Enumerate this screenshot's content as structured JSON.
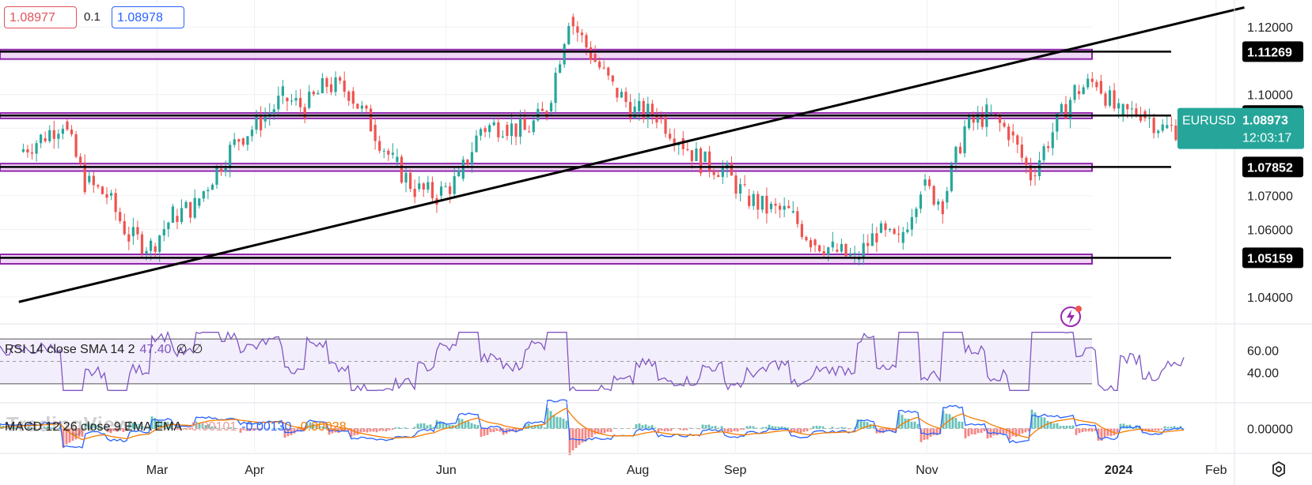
{
  "toolbar": {
    "sell_price": "1.08977",
    "spread": "0.1",
    "buy_price": "1.08978"
  },
  "indicators": {
    "rsi": {
      "label": "RSI 14 close SMA 14 2",
      "value": "47.40",
      "extra1": "∅",
      "extra2": "∅"
    },
    "macd": {
      "label": "MACD 12 26 close 9 EMA EMA",
      "hist": "-0.00101",
      "macd": "-0.00130",
      "signal": "-0.00028"
    }
  },
  "watermark": "TradingView",
  "symbol_badge": {
    "symbol": "EURUSD",
    "price": "1.08973",
    "countdown": "12:03:17",
    "color": "#26a69a"
  },
  "level_labels": [
    "1.12000",
    "1.11269",
    "1.10000",
    "1.09376",
    "1.07852",
    "1.07000",
    "1.06000",
    "1.05159",
    "1.04000"
  ],
  "icons": [
    "settings-icon",
    "lightning-alert-icon"
  ],
  "colors": {
    "up": "#26a69a",
    "down": "#ef5350",
    "zone_fill": "#e9c9f2",
    "zone_border": "#8e24aa",
    "rsi": "#7e57c2",
    "macd": "#2962ff",
    "signal": "#f57c00"
  },
  "chart_data": {
    "type": "candlestick",
    "symbol": "EURUSD",
    "x_ticks": [
      "Mar",
      "Apr",
      "Jun",
      "Aug",
      "Sep",
      "Nov",
      "2024",
      "Feb"
    ],
    "y_ticks": [
      1.12,
      1.11,
      1.1,
      1.09,
      1.08,
      1.07,
      1.06,
      1.04
    ],
    "y_range": [
      1.032,
      1.128
    ],
    "horizontal_levels": [
      1.11269,
      1.09376,
      1.07852,
      1.05159
    ],
    "zones": [
      {
        "low": 1.1105,
        "high": 1.1133
      },
      {
        "low": 1.0929,
        "high": 1.0945
      },
      {
        "low": 1.0773,
        "high": 1.0795
      },
      {
        "low": 1.0498,
        "high": 1.0526
      }
    ],
    "trendline": {
      "from": {
        "date": "2023-01-16",
        "price": 1.0385
      },
      "to": {
        "date": "2024-02-10",
        "price": 1.1258
      }
    },
    "series_close": [
      {
        "date": "2023-01-16",
        "price": 1.083
      },
      {
        "date": "2023-01-23",
        "price": 1.087
      },
      {
        "date": "2023-01-30",
        "price": 1.092
      },
      {
        "date": "2023-02-06",
        "price": 1.074
      },
      {
        "date": "2023-02-13",
        "price": 1.07
      },
      {
        "date": "2023-02-20",
        "price": 1.058
      },
      {
        "date": "2023-02-27",
        "price": 1.055
      },
      {
        "date": "2023-03-06",
        "price": 1.064
      },
      {
        "date": "2023-03-13",
        "price": 1.067
      },
      {
        "date": "2023-03-20",
        "price": 1.078
      },
      {
        "date": "2023-03-27",
        "price": 1.087
      },
      {
        "date": "2023-04-03",
        "price": 1.092
      },
      {
        "date": "2023-04-10",
        "price": 1.099
      },
      {
        "date": "2023-04-17",
        "price": 1.096
      },
      {
        "date": "2023-04-24",
        "price": 1.103
      },
      {
        "date": "2023-05-01",
        "price": 1.101
      },
      {
        "date": "2023-05-08",
        "price": 1.091
      },
      {
        "date": "2023-05-15",
        "price": 1.08
      },
      {
        "date": "2023-05-22",
        "price": 1.072
      },
      {
        "date": "2023-05-29",
        "price": 1.07
      },
      {
        "date": "2023-06-05",
        "price": 1.075
      },
      {
        "date": "2023-06-12",
        "price": 1.09
      },
      {
        "date": "2023-06-19",
        "price": 1.091
      },
      {
        "date": "2023-06-26",
        "price": 1.089
      },
      {
        "date": "2023-07-03",
        "price": 1.095
      },
      {
        "date": "2023-07-10",
        "price": 1.123
      },
      {
        "date": "2023-07-17",
        "price": 1.112
      },
      {
        "date": "2023-07-24",
        "price": 1.102
      },
      {
        "date": "2023-07-31",
        "price": 1.095
      },
      {
        "date": "2023-08-07",
        "price": 1.094
      },
      {
        "date": "2023-08-14",
        "price": 1.087
      },
      {
        "date": "2023-08-21",
        "price": 1.08
      },
      {
        "date": "2023-08-28",
        "price": 1.078
      },
      {
        "date": "2023-09-04",
        "price": 1.07
      },
      {
        "date": "2023-09-11",
        "price": 1.066
      },
      {
        "date": "2023-09-18",
        "price": 1.065
      },
      {
        "date": "2023-09-25",
        "price": 1.057
      },
      {
        "date": "2023-10-02",
        "price": 1.054
      },
      {
        "date": "2023-10-09",
        "price": 1.051
      },
      {
        "date": "2023-10-16",
        "price": 1.059
      },
      {
        "date": "2023-10-23",
        "price": 1.056
      },
      {
        "date": "2023-10-30",
        "price": 1.073
      },
      {
        "date": "2023-11-06",
        "price": 1.068
      },
      {
        "date": "2023-11-13",
        "price": 1.09
      },
      {
        "date": "2023-11-20",
        "price": 1.094
      },
      {
        "date": "2023-11-27",
        "price": 1.089
      },
      {
        "date": "2023-12-04",
        "price": 1.076
      },
      {
        "date": "2023-12-11",
        "price": 1.089
      },
      {
        "date": "2023-12-18",
        "price": 1.101
      },
      {
        "date": "2023-12-25",
        "price": 1.104
      },
      {
        "date": "2024-01-01",
        "price": 1.094
      },
      {
        "date": "2024-01-08",
        "price": 1.095
      },
      {
        "date": "2024-01-15",
        "price": 1.09
      },
      {
        "date": "2024-01-22",
        "price": 1.0897
      }
    ],
    "rsi": {
      "levels": [
        70,
        50,
        30
      ],
      "y_ticks": [
        60.0,
        40.0
      ],
      "range": [
        20,
        80
      ]
    },
    "macd": {
      "y_ticks": [
        0.0
      ],
      "range": [
        -0.012,
        0.012
      ]
    }
  }
}
